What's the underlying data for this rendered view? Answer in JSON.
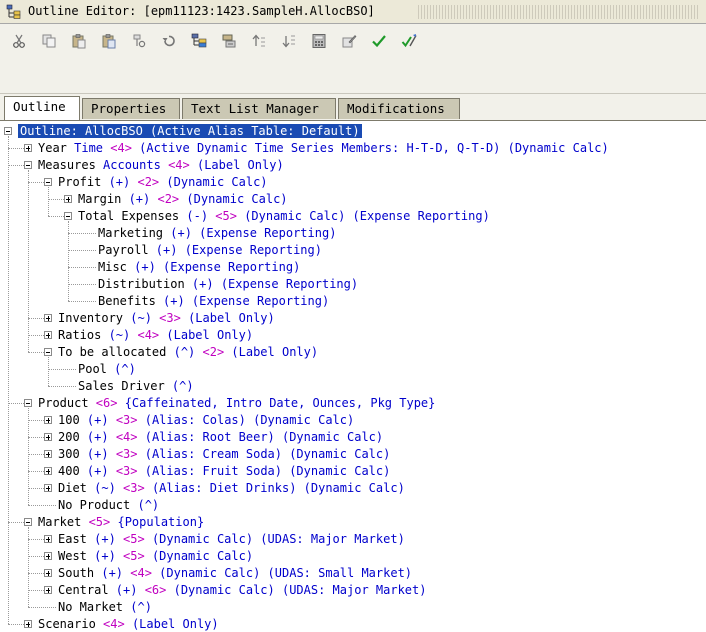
{
  "window": {
    "title": "Outline Editor: [epm11123:1423.SampleH.AllocBSO]",
    "app_icon": "outline-editor-icon"
  },
  "toolbar": {
    "buttons": [
      {
        "name": "cut-icon"
      },
      {
        "name": "copy-icon"
      },
      {
        "name": "paste-icon"
      },
      {
        "name": "paste-special-icon"
      },
      {
        "name": "find-icon"
      },
      {
        "name": "undo-icon"
      },
      {
        "name": "add-child-icon"
      },
      {
        "name": "add-sibling-icon"
      },
      {
        "name": "move-up-icon"
      },
      {
        "name": "move-down-icon"
      },
      {
        "name": "calculator-icon"
      },
      {
        "name": "edit-properties-icon"
      },
      {
        "name": "verify-check-icon"
      },
      {
        "name": "verify-save-icon"
      }
    ]
  },
  "tabs": [
    {
      "label": "Outline",
      "active": true
    },
    {
      "label": "Properties",
      "active": false
    },
    {
      "label": "Text List Manager",
      "active": false
    },
    {
      "label": "Modifications",
      "active": false
    }
  ],
  "tree": [
    {
      "level": 0,
      "expander": "minus",
      "parts": [
        [
          "root-sel",
          "Outline: AllocBSO (Active Alias Table: Default)"
        ]
      ]
    },
    {
      "level": 1,
      "expander": "plus",
      "parts": [
        [
          "label",
          "Year "
        ],
        [
          "dim",
          "Time "
        ],
        [
          "cnt",
          "<4> "
        ],
        [
          "dim",
          "(Active Dynamic Time Series Members: H-T-D, Q-T-D) (Dynamic Calc)"
        ]
      ]
    },
    {
      "level": 1,
      "expander": "minus",
      "parts": [
        [
          "label",
          "Measures "
        ],
        [
          "dim",
          "Accounts "
        ],
        [
          "cnt",
          "<4> "
        ],
        [
          "dim",
          "(Label Only)"
        ]
      ]
    },
    {
      "level": 2,
      "expander": "minus",
      "parts": [
        [
          "label",
          "Profit "
        ],
        [
          "dim",
          "(+) "
        ],
        [
          "cnt",
          "<2> "
        ],
        [
          "dim",
          "(Dynamic Calc)"
        ]
      ]
    },
    {
      "level": 3,
      "expander": "plus",
      "parts": [
        [
          "label",
          "Margin "
        ],
        [
          "dim",
          "(+) "
        ],
        [
          "cnt",
          "<2> "
        ],
        [
          "dim",
          "(Dynamic Calc)"
        ]
      ]
    },
    {
      "level": 3,
      "expander": "minus",
      "parts": [
        [
          "label",
          "Total Expenses "
        ],
        [
          "dim",
          "(-) "
        ],
        [
          "cnt",
          "<5> "
        ],
        [
          "dim",
          "(Dynamic Calc) (Expense Reporting)"
        ]
      ]
    },
    {
      "level": 4,
      "expander": "none",
      "parts": [
        [
          "label",
          "Marketing "
        ],
        [
          "dim",
          "(+) (Expense Reporting)"
        ]
      ]
    },
    {
      "level": 4,
      "expander": "none",
      "parts": [
        [
          "label",
          "Payroll "
        ],
        [
          "dim",
          "(+) (Expense Reporting)"
        ]
      ]
    },
    {
      "level": 4,
      "expander": "none",
      "parts": [
        [
          "label",
          "Misc "
        ],
        [
          "dim",
          "(+) (Expense Reporting)"
        ]
      ]
    },
    {
      "level": 4,
      "expander": "none",
      "parts": [
        [
          "label",
          "Distribution "
        ],
        [
          "dim",
          "(+) (Expense Reporting)"
        ]
      ]
    },
    {
      "level": 4,
      "expander": "none",
      "parts": [
        [
          "label",
          "Benefits "
        ],
        [
          "dim",
          "(+) (Expense Reporting)"
        ]
      ]
    },
    {
      "level": 2,
      "expander": "plus",
      "parts": [
        [
          "label",
          "Inventory "
        ],
        [
          "dim",
          "(~) "
        ],
        [
          "cnt",
          "<3> "
        ],
        [
          "dim",
          "(Label Only)"
        ]
      ]
    },
    {
      "level": 2,
      "expander": "plus",
      "parts": [
        [
          "label",
          "Ratios "
        ],
        [
          "dim",
          "(~) "
        ],
        [
          "cnt",
          "<4> "
        ],
        [
          "dim",
          "(Label Only)"
        ]
      ]
    },
    {
      "level": 2,
      "expander": "minus",
      "parts": [
        [
          "label",
          "To be allocated "
        ],
        [
          "dim",
          "(^) "
        ],
        [
          "cnt",
          "<2> "
        ],
        [
          "dim",
          "(Label Only)"
        ]
      ]
    },
    {
      "level": 3,
      "expander": "none",
      "parts": [
        [
          "label",
          "Pool "
        ],
        [
          "dim",
          "(^)"
        ]
      ]
    },
    {
      "level": 3,
      "expander": "none",
      "parts": [
        [
          "label",
          "Sales Driver "
        ],
        [
          "dim",
          "(^)"
        ]
      ]
    },
    {
      "level": 1,
      "expander": "minus",
      "parts": [
        [
          "label",
          "Product "
        ],
        [
          "cnt",
          "<6> "
        ],
        [
          "dim",
          "{Caffeinated, Intro Date, Ounces, Pkg Type}"
        ]
      ]
    },
    {
      "level": 2,
      "expander": "plus",
      "parts": [
        [
          "label",
          "100 "
        ],
        [
          "dim",
          "(+) "
        ],
        [
          "cnt",
          "<3> "
        ],
        [
          "dim",
          "(Alias: Colas) (Dynamic Calc)"
        ]
      ]
    },
    {
      "level": 2,
      "expander": "plus",
      "parts": [
        [
          "label",
          "200 "
        ],
        [
          "dim",
          "(+) "
        ],
        [
          "cnt",
          "<4> "
        ],
        [
          "dim",
          "(Alias: Root Beer) (Dynamic Calc)"
        ]
      ]
    },
    {
      "level": 2,
      "expander": "plus",
      "parts": [
        [
          "label",
          "300 "
        ],
        [
          "dim",
          "(+) "
        ],
        [
          "cnt",
          "<3> "
        ],
        [
          "dim",
          "(Alias: Cream Soda) (Dynamic Calc)"
        ]
      ]
    },
    {
      "level": 2,
      "expander": "plus",
      "parts": [
        [
          "label",
          "400 "
        ],
        [
          "dim",
          "(+) "
        ],
        [
          "cnt",
          "<3> "
        ],
        [
          "dim",
          "(Alias: Fruit Soda) (Dynamic Calc)"
        ]
      ]
    },
    {
      "level": 2,
      "expander": "plus",
      "parts": [
        [
          "label",
          "Diet "
        ],
        [
          "dim",
          "(~) "
        ],
        [
          "cnt",
          "<3> "
        ],
        [
          "dim",
          "(Alias: Diet Drinks) (Dynamic Calc)"
        ]
      ]
    },
    {
      "level": 2,
      "expander": "none",
      "parts": [
        [
          "label",
          "No Product "
        ],
        [
          "dim",
          "(^)"
        ]
      ]
    },
    {
      "level": 1,
      "expander": "minus",
      "parts": [
        [
          "label",
          "Market "
        ],
        [
          "cnt",
          "<5> "
        ],
        [
          "dim",
          "{Population}"
        ]
      ]
    },
    {
      "level": 2,
      "expander": "plus",
      "parts": [
        [
          "label",
          "East "
        ],
        [
          "dim",
          "(+) "
        ],
        [
          "cnt",
          "<5> "
        ],
        [
          "dim",
          "(Dynamic Calc) (UDAS: Major Market)"
        ]
      ]
    },
    {
      "level": 2,
      "expander": "plus",
      "parts": [
        [
          "label",
          "West "
        ],
        [
          "dim",
          "(+) "
        ],
        [
          "cnt",
          "<5> "
        ],
        [
          "dim",
          "(Dynamic Calc)"
        ]
      ]
    },
    {
      "level": 2,
      "expander": "plus",
      "parts": [
        [
          "label",
          "South "
        ],
        [
          "dim",
          "(+) "
        ],
        [
          "cnt",
          "<4> "
        ],
        [
          "dim",
          "(Dynamic Calc) (UDAS: Small Market)"
        ]
      ]
    },
    {
      "level": 2,
      "expander": "plus",
      "parts": [
        [
          "label",
          "Central "
        ],
        [
          "dim",
          "(+) "
        ],
        [
          "cnt",
          "<6> "
        ],
        [
          "dim",
          "(Dynamic Calc) (UDAS: Major Market)"
        ]
      ]
    },
    {
      "level": 2,
      "expander": "none",
      "parts": [
        [
          "label",
          "No Market "
        ],
        [
          "dim",
          "(^)"
        ]
      ]
    },
    {
      "level": 1,
      "expander": "plus",
      "parts": [
        [
          "label",
          "Scenario "
        ],
        [
          "cnt",
          "<4> "
        ],
        [
          "dim",
          "(Label Only)"
        ]
      ]
    }
  ],
  "colors": {
    "selection": "#1a4bb3",
    "member_info": "#0000cc",
    "child_count": "#c000c0",
    "tab_inactive": "#cbc8b4"
  }
}
